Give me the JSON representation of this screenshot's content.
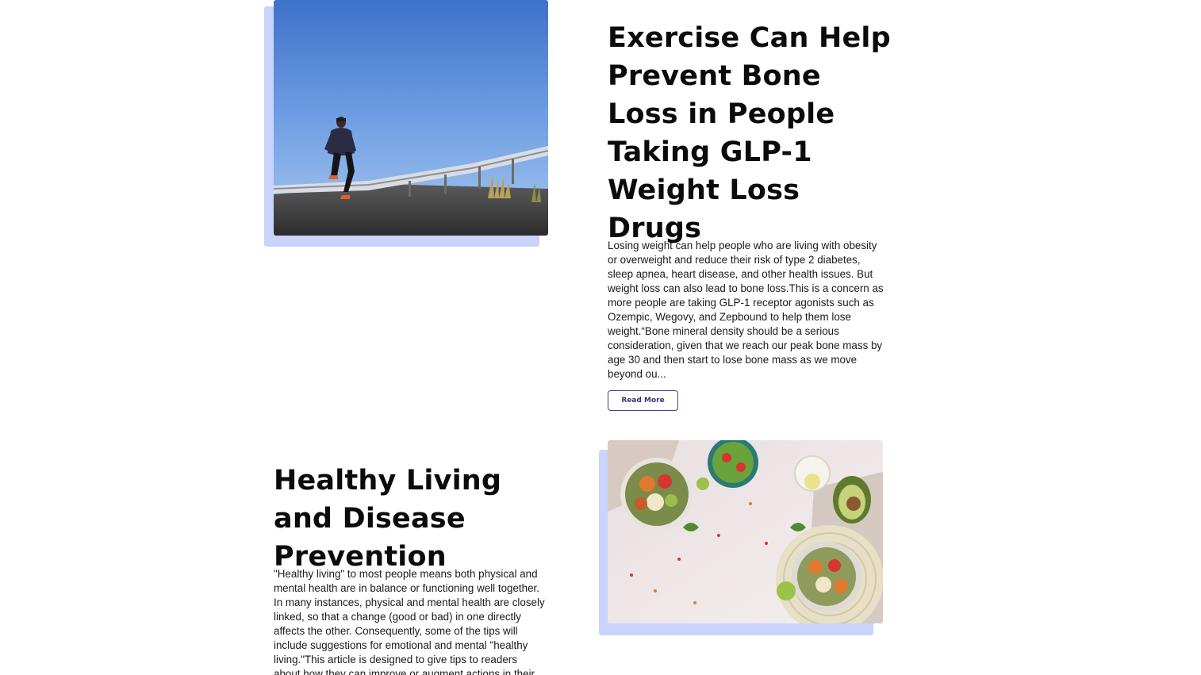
{
  "articles": [
    {
      "title": "Exercise Can Help Prevent Bone Loss in People Taking GLP-1 Weight Loss Drugs",
      "excerpt": "Losing weight can help people who are living with obesity or overweight and reduce their risk of type 2 diabetes, sleep apnea, heart disease, and other health issues. But weight loss can also lead to bone loss.This is a concern as more people are taking GLP-1 receptor agonists such as Ozempic, Wegovy, and Zepbound to help them lose weight.“Bone mineral density should be a serious consideration, given that we reach our peak bone mass by age 30 and then start to lose bone mass as we move beyond ou...",
      "read_more_label": "Read More",
      "image": "runner-on-road-photo"
    },
    {
      "title": "Healthy Living and Disease Prevention",
      "excerpt": "\"Healthy living\" to most people means both physical and mental health are in balance or functioning well together. In many instances, physical and mental health are closely linked, so that a change (good or bad) in one directly affects the other. Consequently, some of the tips will include suggestions for emotional and mental \"healthy living.\"This article is designed to give tips to readers about how they can improve or augment actions in their life to have a healthy lifestyle",
      "image": "salad-bowls-photo"
    }
  ],
  "colors": {
    "image_shadow": "#c9d3fb",
    "button_border": "#4a3f8c",
    "button_text": "#3c3378",
    "heading": "#0b0b0b"
  }
}
